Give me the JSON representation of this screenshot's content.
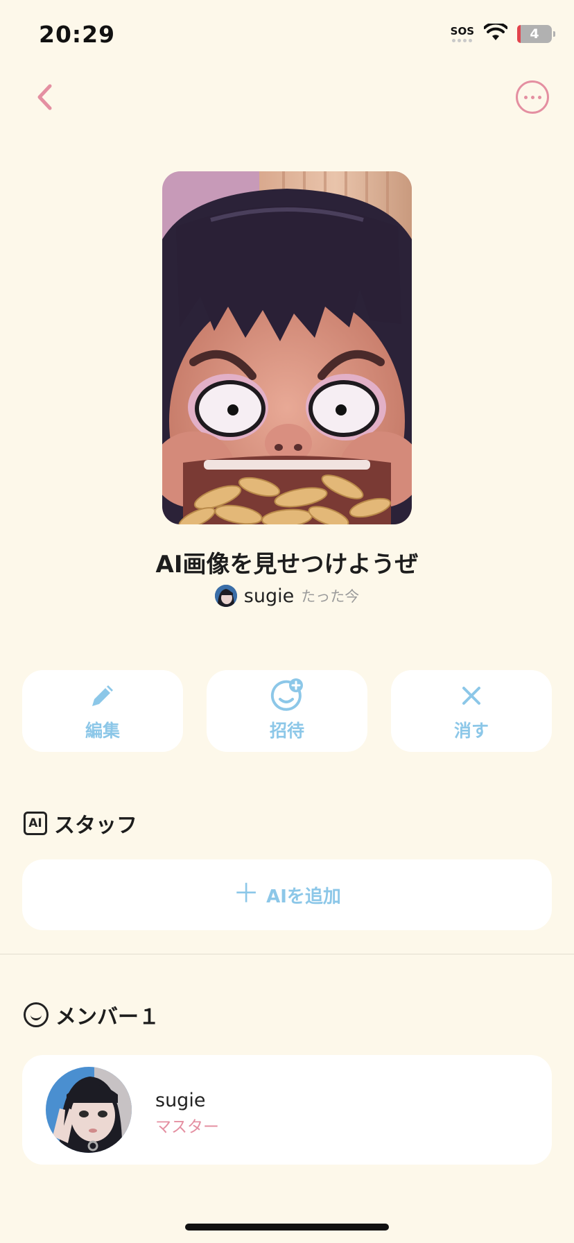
{
  "status_bar": {
    "time": "20:29",
    "sos": "SOS",
    "battery": "4",
    "wifi_icon": "wifi-icon"
  },
  "nav": {
    "back_icon": "chevron-left-icon",
    "more_icon": "ellipsis-circle-icon",
    "accent_color": "#e48fa1"
  },
  "group": {
    "title": "AI画像を見せつけようぜ",
    "owner_name": "sugie",
    "posted_time": "たった今"
  },
  "actions": [
    {
      "label": "編集",
      "icon": "pencil-icon"
    },
    {
      "label": "招待",
      "icon": "add-face-icon"
    },
    {
      "label": "消す",
      "icon": "close-icon"
    }
  ],
  "staff_section": {
    "badge": "AI",
    "title": "スタッフ",
    "add_label": "AIを追加"
  },
  "members_section": {
    "title": "メンバー１",
    "members": [
      {
        "name": "sugie",
        "role": "マスター"
      }
    ]
  },
  "colors": {
    "background": "#fdf8ea",
    "action_blue": "#8cc7e8",
    "role_pink": "#e48fa1"
  }
}
